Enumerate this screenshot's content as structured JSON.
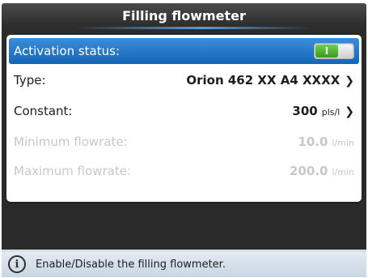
{
  "window": {
    "title": "Filling flowmeter"
  },
  "settings": {
    "activation": {
      "label": "Activation status:",
      "toggle_on_label": "I",
      "enabled": true
    },
    "type": {
      "label": "Type:",
      "value": "Orion 462 XX A4 XXXX",
      "chevron": "❯"
    },
    "constant": {
      "label": "Constant:",
      "value": "300",
      "unit": "pls/l",
      "chevron": "❯"
    },
    "min_flowrate": {
      "label": "Minimum flowrate:",
      "value": "10.0",
      "unit": "l/min"
    },
    "max_flowrate": {
      "label": "Maximum flowrate:",
      "value": "200.0",
      "unit": "l/min"
    }
  },
  "status": {
    "icon": "info-icon",
    "icon_glyph": "i",
    "text": "Enable/Disable the filling flowmeter."
  },
  "colors": {
    "selection": "#1f74c9",
    "toggle_on": "#4cb530",
    "title_bar": "#3a3a3a",
    "disabled_text": "#c8c8c8"
  }
}
